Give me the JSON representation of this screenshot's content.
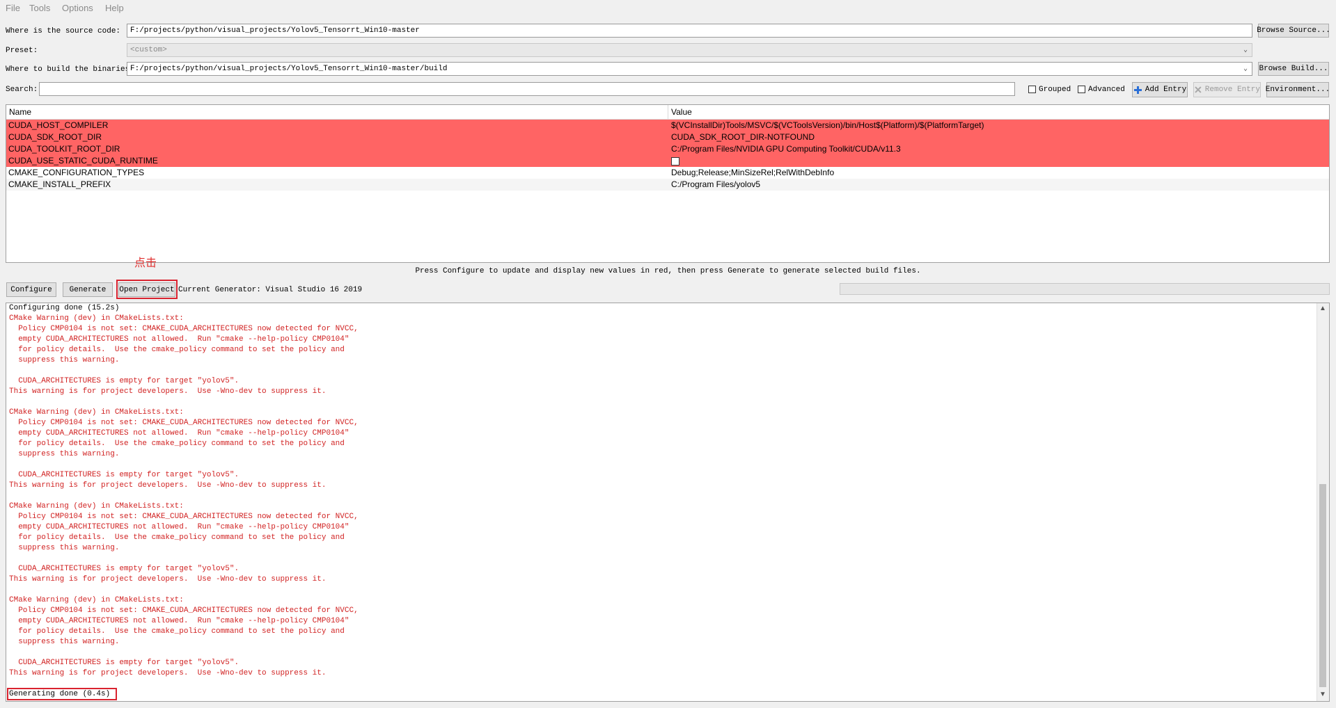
{
  "menu": [
    "File",
    "Tools",
    "Options",
    "Help"
  ],
  "source": {
    "label": "Where is the source code:",
    "value": "F:/projects/python/visual_projects/Yolov5_Tensorrt_Win10-master",
    "button": "Browse Source..."
  },
  "preset": {
    "label": "Preset:",
    "value": "<custom>"
  },
  "build": {
    "label": "Where to build the binaries:",
    "value": "F:/projects/python/visual_projects/Yolov5_Tensorrt_Win10-master/build",
    "button": "Browse Build..."
  },
  "search": {
    "label": "Search:",
    "value": "",
    "grouped_label": "Grouped",
    "advanced_label": "Advanced",
    "add_entry": "Add Entry",
    "remove_entry": "Remove Entry",
    "environment": "Environment..."
  },
  "table": {
    "headers": [
      "Name",
      "Value"
    ],
    "rows": [
      {
        "name": "CUDA_HOST_COMPILER",
        "value": "$(VCInstallDir)Tools/MSVC/$(VCToolsVersion)/bin/Host$(Platform)/$(PlatformTarget)",
        "highlight": true
      },
      {
        "name": "CUDA_SDK_ROOT_DIR",
        "value": "CUDA_SDK_ROOT_DIR-NOTFOUND",
        "highlight": true
      },
      {
        "name": "CUDA_TOOLKIT_ROOT_DIR",
        "value": "C:/Program Files/NVIDIA GPU Computing Toolkit/CUDA/v11.3",
        "highlight": true
      },
      {
        "name": "CUDA_USE_STATIC_CUDA_RUNTIME",
        "value": "",
        "checkbox": true,
        "checked": false,
        "highlight": true
      },
      {
        "name": "CMAKE_CONFIGURATION_TYPES",
        "value": "Debug;Release;MinSizeRel;RelWithDebInfo",
        "highlight": false
      },
      {
        "name": "CMAKE_INSTALL_PREFIX",
        "value": "C:/Program Files/yolov5",
        "highlight": false
      }
    ]
  },
  "annotation": "点击",
  "hint": "Press Configure to update and display new values in red, then press Generate to generate selected build files.",
  "actions": {
    "configure": "Configure",
    "generate": "Generate",
    "open_project": "Open Project",
    "current_generator": "Current Generator: Visual Studio 16 2019"
  },
  "progress": 0,
  "log": [
    {
      "text": "Configuring done (15.2s)",
      "color": "black"
    },
    {
      "text": "CMake Warning (dev) in CMakeLists.txt:",
      "color": "red"
    },
    {
      "text": "  Policy CMP0104 is not set: CMAKE_CUDA_ARCHITECTURES now detected for NVCC,",
      "color": "red"
    },
    {
      "text": "  empty CUDA_ARCHITECTURES not allowed.  Run \"cmake --help-policy CMP0104\"",
      "color": "red"
    },
    {
      "text": "  for policy details.  Use the cmake_policy command to set the policy and",
      "color": "red"
    },
    {
      "text": "  suppress this warning.",
      "color": "red"
    },
    {
      "text": "",
      "color": "red"
    },
    {
      "text": "  CUDA_ARCHITECTURES is empty for target \"yolov5\".",
      "color": "red"
    },
    {
      "text": "This warning is for project developers.  Use -Wno-dev to suppress it.",
      "color": "red"
    },
    {
      "text": "",
      "color": "red"
    },
    {
      "text": "CMake Warning (dev) in CMakeLists.txt:",
      "color": "red"
    },
    {
      "text": "  Policy CMP0104 is not set: CMAKE_CUDA_ARCHITECTURES now detected for NVCC,",
      "color": "red"
    },
    {
      "text": "  empty CUDA_ARCHITECTURES not allowed.  Run \"cmake --help-policy CMP0104\"",
      "color": "red"
    },
    {
      "text": "  for policy details.  Use the cmake_policy command to set the policy and",
      "color": "red"
    },
    {
      "text": "  suppress this warning.",
      "color": "red"
    },
    {
      "text": "",
      "color": "red"
    },
    {
      "text": "  CUDA_ARCHITECTURES is empty for target \"yolov5\".",
      "color": "red"
    },
    {
      "text": "This warning is for project developers.  Use -Wno-dev to suppress it.",
      "color": "red"
    },
    {
      "text": "",
      "color": "red"
    },
    {
      "text": "CMake Warning (dev) in CMakeLists.txt:",
      "color": "red"
    },
    {
      "text": "  Policy CMP0104 is not set: CMAKE_CUDA_ARCHITECTURES now detected for NVCC,",
      "color": "red"
    },
    {
      "text": "  empty CUDA_ARCHITECTURES not allowed.  Run \"cmake --help-policy CMP0104\"",
      "color": "red"
    },
    {
      "text": "  for policy details.  Use the cmake_policy command to set the policy and",
      "color": "red"
    },
    {
      "text": "  suppress this warning.",
      "color": "red"
    },
    {
      "text": "",
      "color": "red"
    },
    {
      "text": "  CUDA_ARCHITECTURES is empty for target \"yolov5\".",
      "color": "red"
    },
    {
      "text": "This warning is for project developers.  Use -Wno-dev to suppress it.",
      "color": "red"
    },
    {
      "text": "",
      "color": "red"
    },
    {
      "text": "CMake Warning (dev) in CMakeLists.txt:",
      "color": "red"
    },
    {
      "text": "  Policy CMP0104 is not set: CMAKE_CUDA_ARCHITECTURES now detected for NVCC,",
      "color": "red"
    },
    {
      "text": "  empty CUDA_ARCHITECTURES not allowed.  Run \"cmake --help-policy CMP0104\"",
      "color": "red"
    },
    {
      "text": "  for policy details.  Use the cmake_policy command to set the policy and",
      "color": "red"
    },
    {
      "text": "  suppress this warning.",
      "color": "red"
    },
    {
      "text": "",
      "color": "red"
    },
    {
      "text": "  CUDA_ARCHITECTURES is empty for target \"yolov5\".",
      "color": "red"
    },
    {
      "text": "This warning is for project developers.  Use -Wno-dev to suppress it.",
      "color": "red"
    },
    {
      "text": "",
      "color": "red"
    },
    {
      "text": "Generating done (0.4s)",
      "color": "black"
    }
  ],
  "colors": {
    "highlight_row": "#ff6464",
    "log_red": "#d12222",
    "annotation_red": "#d9232f"
  },
  "icons": {
    "add_entry": "plus-icon",
    "remove_entry": "remove-icon",
    "combo": "chevron-down-icon"
  }
}
